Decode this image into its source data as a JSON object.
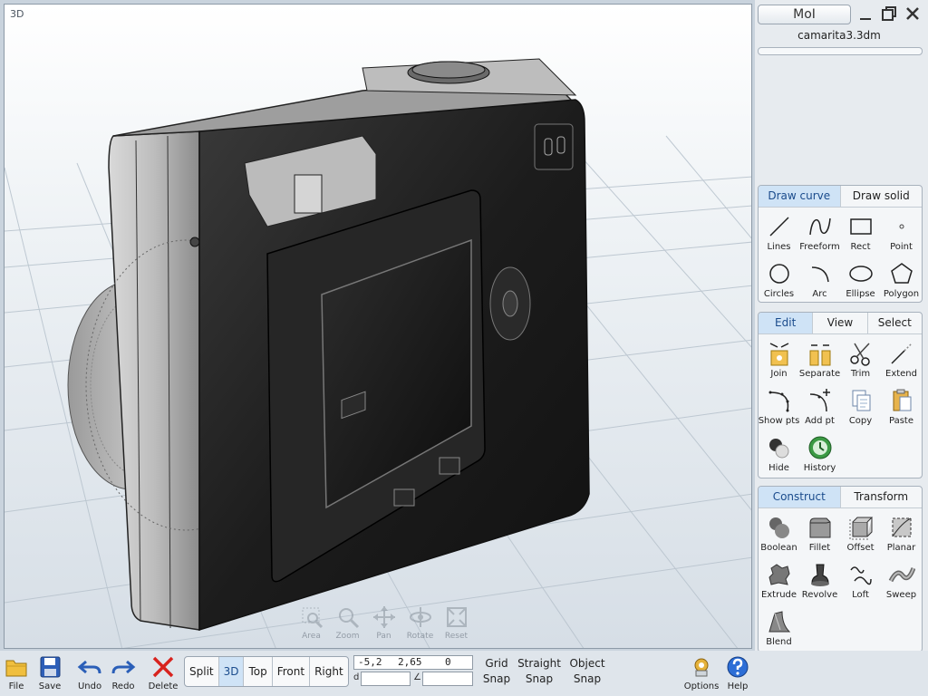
{
  "viewport": {
    "label": "3D",
    "nav_tools": [
      {
        "label": "Area",
        "icon": "area-zoom-icon"
      },
      {
        "label": "Zoom",
        "icon": "magnifier-icon"
      },
      {
        "label": "Pan",
        "icon": "pan-arrows-icon"
      },
      {
        "label": "Rotate",
        "icon": "rotate-icon"
      },
      {
        "label": "Reset",
        "icon": "reset-view-icon"
      }
    ]
  },
  "app": {
    "title": "MoI",
    "file_name": "camarita3.3dm"
  },
  "draw_pane": {
    "tabs": [
      "Draw curve",
      "Draw solid"
    ],
    "active_tab": 0,
    "tools": [
      "Lines",
      "Freeform",
      "Rect",
      "Point",
      "Circles",
      "Arc",
      "Ellipse",
      "Polygon"
    ]
  },
  "edit_pane": {
    "tabs": [
      "Edit",
      "View",
      "Select"
    ],
    "active_tab": 0,
    "tools": [
      "Join",
      "Separate",
      "Trim",
      "Extend",
      "Show pts",
      "Add pt",
      "Copy",
      "Paste",
      "Hide",
      "History"
    ]
  },
  "construct_pane": {
    "tabs": [
      "Construct",
      "Transform"
    ],
    "active_tab": 0,
    "tools": [
      "Boolean",
      "Fillet",
      "Offset",
      "Planar",
      "Extrude",
      "Revolve",
      "Loft",
      "Sweep",
      "Blend"
    ]
  },
  "bottom": {
    "file_tools": [
      "File",
      "Save",
      "Undo",
      "Redo",
      "Delete"
    ],
    "views": [
      "Split",
      "3D",
      "Top",
      "Front",
      "Right"
    ],
    "active_view": "3D",
    "coords": {
      "x": "-5,2",
      "y": "2,65",
      "z": "0",
      "d_label": "d",
      "angle_label": "∠"
    },
    "snaps": [
      {
        "line1": "Grid",
        "line2": "Snap"
      },
      {
        "line1": "Straight",
        "line2": "Snap"
      },
      {
        "line1": "Object",
        "line2": "Snap"
      }
    ],
    "right_tools": [
      "Options",
      "Help"
    ]
  },
  "colors": {
    "accent": "#cfe3f6",
    "accent_text": "#1a4b8c",
    "delete_red": "#d8231e",
    "undo_blue": "#2b5fb8"
  }
}
